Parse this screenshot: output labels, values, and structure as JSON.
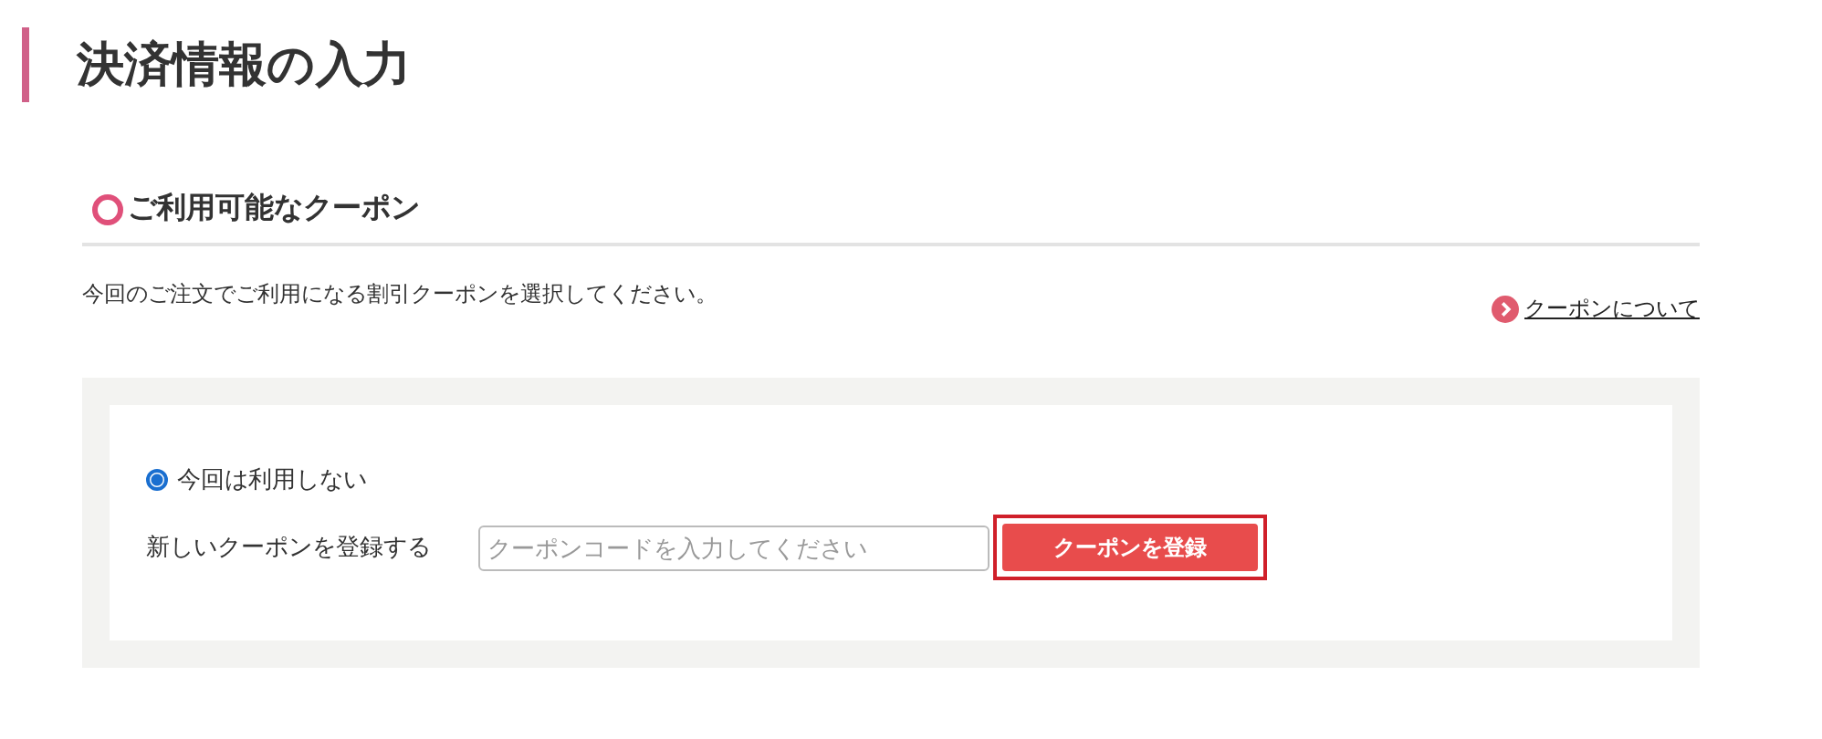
{
  "page_title": "決済情報の入力",
  "section": {
    "title": "ご利用可能なクーポン",
    "description": "今回のご注文でご利用になる割引クーポンを選択してください。",
    "link": "クーポンについて"
  },
  "options": [
    {
      "label": "今回は利用しない",
      "selected": true
    }
  ],
  "register": {
    "label": "新しいクーポンを登録する",
    "placeholder": "クーポンコードを入力してください",
    "button": "クーポンを登録",
    "highlighted": true
  }
}
